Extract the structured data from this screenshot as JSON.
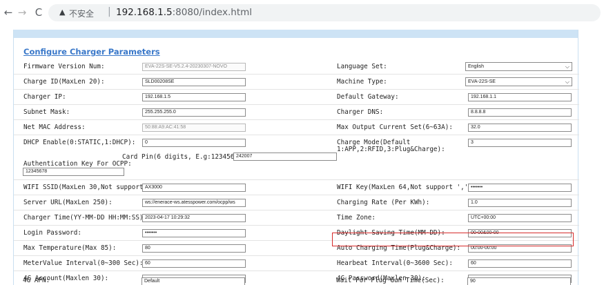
{
  "browser": {
    "back_icon": "←",
    "forward_icon": "→",
    "reload_icon": "C",
    "warning_icon": "▲",
    "warning_text": "不安全",
    "separator": "|",
    "url_host": "192.168.1.5",
    "url_rest": ":8080/index.html"
  },
  "page": {
    "title": "Configure Charger Parameters"
  },
  "left": {
    "firmware_label": "Firmware Version Num:",
    "firmware_value": "EVA-22S-SE-V5.2.4-20230307-NOVO",
    "charge_id_label": "Charge ID(MaxLen 20):",
    "charge_id_value": "SLD00208SE",
    "charger_ip_label": "Charger IP:",
    "charger_ip_value": "192.168.1.5",
    "subnet_label": "Subnet Mask:",
    "subnet_value": "255.255.255.0",
    "mac_label": "Net MAC Address:",
    "mac_value": "50:88:A9:AC:41:58",
    "dhcp_label": "DHCP Enable(0:STATIC,1:DHCP):",
    "dhcp_value": "0",
    "card_pin_label": "Card Pin(6 digits, E.g:123456):",
    "card_pin_value": "242007",
    "auth_key_label": "Authentication Key For OCPP:",
    "auth_key_value": "12345678",
    "wifi_ssid_label": "WIFI SSID(MaxLen 30,Not support ','):",
    "wifi_ssid_value": "AX3000",
    "server_url_label": "Server URL(MaxLen 250):",
    "server_url_value": "ws://enerace-ws.atesspower.com/ocpp/ws",
    "charger_time_label": "Charger Time(YY-MM-DD HH:MM:SS):",
    "charger_time_value": "2023-04-17 10:29:32",
    "login_pw_label": "Login Password:",
    "login_pw_value": "•••••••",
    "max_temp_label": "Max Temperature(Max 85):",
    "max_temp_value": "80",
    "meter_interval_label": "MeterValue Interval(0~300 Sec):",
    "meter_interval_value": "60",
    "account_4g_label": "4G Account(Maxlen 30):",
    "account_4g_value": "",
    "apn_4g_label": "4G APN:",
    "apn_4g_value": "Default"
  },
  "right": {
    "language_label": "Language Set:",
    "language_value": "English",
    "machine_type_label": "Machine Type:",
    "machine_type_value": "EVA-22S-SE",
    "gateway_label": "Default Gateway:",
    "gateway_value": "192.168.1.1",
    "dns_label": "Charger DNS:",
    "dns_value": "8.8.8.8",
    "max_current_label": "Max Output Current Set(6~63A):",
    "max_current_value": "32.0",
    "charge_mode_label_1": "Charge Mode(Default",
    "charge_mode_label_2": "1:APP,2:RFID,3:Plug&Charge):",
    "charge_mode_value": "3",
    "wifi_key_label": "WIFI Key(MaxLen 64,Not support ','):",
    "wifi_key_value": "•••••••",
    "rate_label": "Charging Rate (Per KWh):",
    "rate_value": "1.0",
    "timezone_label": "Time Zone:",
    "timezone_value": "UTC+00:00",
    "dst_label": "Daylight Saving Time(MM-DD):",
    "dst_value": "00-00&00-00",
    "auto_charge_label": "Auto Charging Time(Plug&Charge):",
    "auto_charge_value": "00:00-00:00",
    "heartbeat_label": "Hearbeat Interval(0~3600 Sec):",
    "heartbeat_value": "60",
    "password_4g_label": "4G Password(Maxlen 30):",
    "password_4g_value": "",
    "plug_gun_label": "Wait For Plug Gun Time(Sec):",
    "plug_gun_value": "90"
  },
  "icons": {
    "select_chevron": "⌵"
  },
  "colors": {
    "title": "#3a78c9",
    "highlight": "#d62a2a",
    "frame_top": "#cde3f5"
  }
}
